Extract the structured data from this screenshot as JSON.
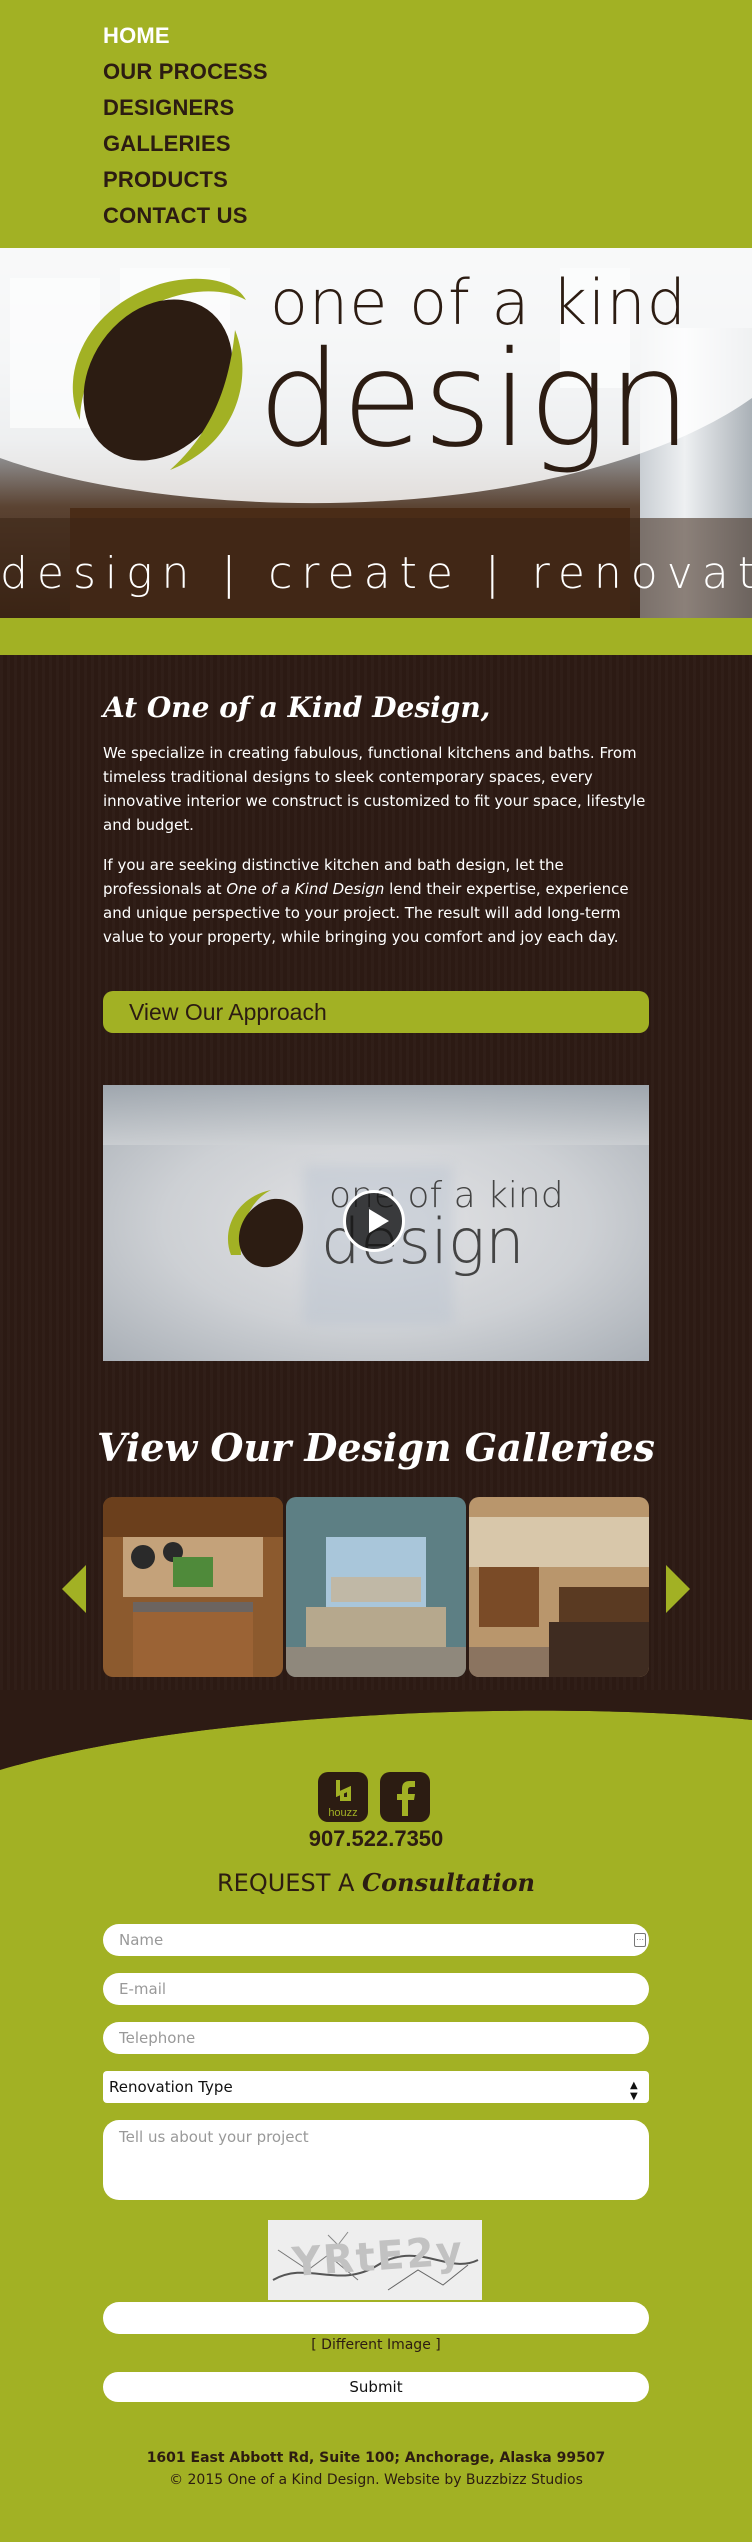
{
  "nav": {
    "items": [
      {
        "label": "HOME",
        "active": true
      },
      {
        "label": "OUR PROCESS",
        "active": false
      },
      {
        "label": "DESIGNERS",
        "active": false
      },
      {
        "label": "GALLERIES",
        "active": false
      },
      {
        "label": "PRODUCTS",
        "active": false
      },
      {
        "label": "CONTACT US",
        "active": false
      }
    ]
  },
  "hero": {
    "logo_line1": "one of a kind",
    "logo_line2": "design",
    "tagline": "design | create | renovate"
  },
  "intro": {
    "heading": "At One of a Kind Design,",
    "paragraph1": "We specialize in creating fabulous, functional kitchens and baths. From timeless traditional designs to sleek contemporary spaces, every innovative interior we construct is customized to fit your space, lifestyle and budget.",
    "paragraph2_before": "If you are seeking distinctive kitchen and bath design, let the professionals at ",
    "paragraph2_em": "One of a Kind Design",
    "paragraph2_after": " lend their expertise, experience and unique perspective to your project. The result will add long-term value to your property, while bringing you comfort and joy each day.",
    "button_label": "View Our Approach"
  },
  "video": {
    "logo_line1": "one of a kind",
    "logo_line2": "design"
  },
  "galleries": {
    "title": "View Our Design Galleries"
  },
  "contact": {
    "houzz_label": "houzz",
    "phone": "907.522.7350",
    "request_prefix": "REQUEST A",
    "request_script": "Consultation",
    "name_placeholder": "Name",
    "email_placeholder": "E-mail",
    "telephone_placeholder": "Telephone",
    "renovation_selected": "Renovation Type",
    "project_placeholder": "Tell us about your project",
    "captcha_text": "YRtE2y",
    "different_image": "[ Different Image ]",
    "submit_label": "Submit"
  },
  "footer": {
    "address": "1601 East Abbott Rd, Suite 100; Anchorage, Alaska 99507",
    "copyright": "© 2015 One of a Kind Design. Website by Buzzbizz Studios"
  },
  "colors": {
    "accent_green": "#a2b124",
    "dark_brown": "#2d1b14",
    "logo_brown": "#2c1c12"
  }
}
